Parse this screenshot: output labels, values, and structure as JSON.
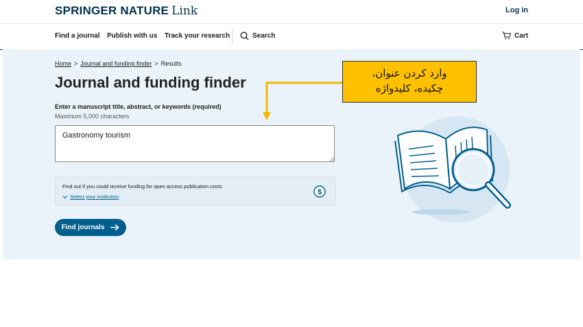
{
  "header": {
    "logo_brand": "SPRINGER NATURE",
    "logo_link": "Link",
    "login_label": "Log in"
  },
  "nav": {
    "items": [
      "Find a journal",
      "Publish with us",
      "Track your research"
    ],
    "search_label": "Search",
    "cart_label": "Cart"
  },
  "breadcrumb": {
    "home": "Home",
    "finder": "Journal and funding finder",
    "current": "Results",
    "separator": ">"
  },
  "page": {
    "title": "Journal and funding finder",
    "field_label": "Enter a manuscript title, abstract, or keywords (required)",
    "field_hint": "Maximum 5,000 characters",
    "field_value": "Gastronomy tourism"
  },
  "funding": {
    "text": "Find out if you could receive funding for open access publication costs",
    "link": "Select your institution"
  },
  "actions": {
    "find_label": "Find journals"
  },
  "annotation": {
    "line1": "وارد کردن عنوان،",
    "line2": "چکیده، کلیدواژه"
  },
  "colors": {
    "brand": "#01324b",
    "accent": "#025e8d",
    "hero_bg": "#eaf3f9",
    "callout": "#ffc000"
  }
}
